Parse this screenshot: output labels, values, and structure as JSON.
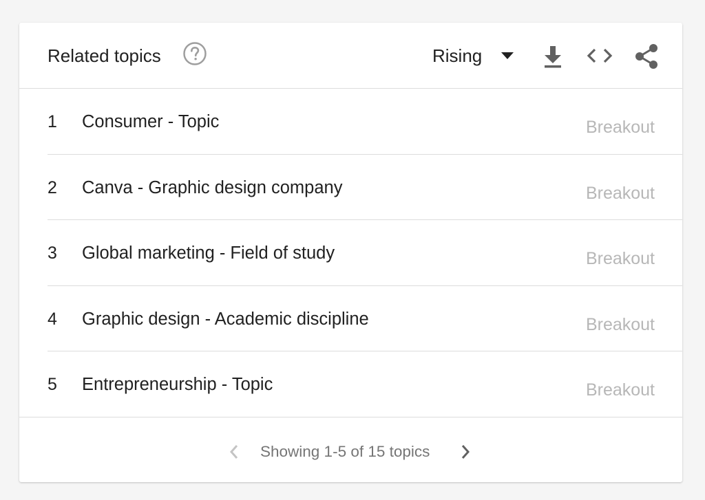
{
  "header": {
    "title": "Related topics",
    "sort_selected": "Rising"
  },
  "icons": {
    "help": "help-circle-icon",
    "caret": "caret-down-icon",
    "download": "download-icon",
    "embed": "embed-code-icon",
    "share": "share-icon",
    "prev": "chevron-left-icon",
    "next": "chevron-right-icon"
  },
  "rows": [
    {
      "rank": "1",
      "topic": "Consumer - Topic",
      "value": "Breakout"
    },
    {
      "rank": "2",
      "topic": "Canva - Graphic design company",
      "value": "Breakout"
    },
    {
      "rank": "3",
      "topic": "Global marketing - Field of study",
      "value": "Breakout"
    },
    {
      "rank": "4",
      "topic": "Graphic design - Academic discipline",
      "value": "Breakout"
    },
    {
      "rank": "5",
      "topic": "Entrepreneurship - Topic",
      "value": "Breakout"
    }
  ],
  "pagination": {
    "text": "Showing 1-5 of 15 topics"
  },
  "colors": {
    "text": "#212121",
    "muted": "#b7b7b7",
    "icon": "#616161",
    "divider": "#dcdcdc",
    "background": "#f5f5f5"
  }
}
